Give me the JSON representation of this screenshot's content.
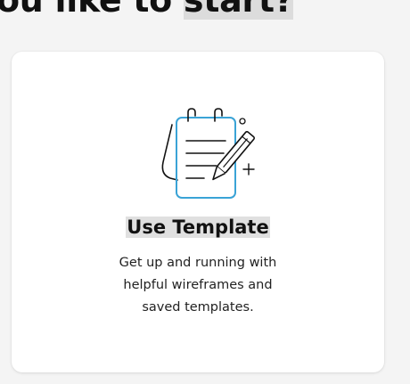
{
  "heading": {
    "text_before": "ou like to ",
    "text_highlight": "start?"
  },
  "card": {
    "title": "Use Template",
    "description": "Get up and running with helpful wireframes and saved templates.",
    "icon": "notepad-pencil-icon",
    "accent_color": "#3aa3d6"
  }
}
